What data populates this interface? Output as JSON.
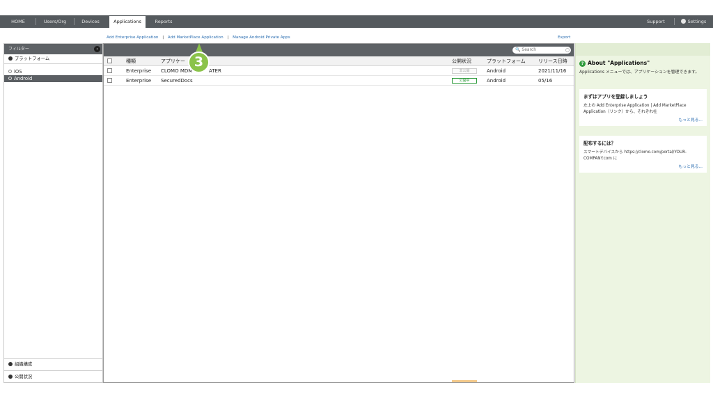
{
  "nav": {
    "tabs": [
      {
        "label": "HOME"
      },
      {
        "label": "Users/Org"
      },
      {
        "label": "Devices"
      },
      {
        "label": "Applications"
      },
      {
        "label": "Reports"
      }
    ],
    "active_tab": "Applications",
    "support": "Support",
    "settings": "Settings"
  },
  "actions": {
    "add_enterprise": "Add Enterprise Application",
    "add_marketplace": "Add MarketPlace Application",
    "manage_android": "Manage Android Private Apps",
    "separator": "|",
    "export": "Export"
  },
  "sidebar": {
    "filter_title": "フィルター",
    "platform_section": "プラットフォーム",
    "platforms": [
      {
        "label": "iOS",
        "selected": false
      },
      {
        "label": "Android",
        "selected": true
      }
    ],
    "org_section": "組織構成",
    "status_section": "公開状況"
  },
  "table": {
    "search_placeholder": "Search",
    "columns": [
      "種類",
      "アプリケー",
      "公開状況",
      "プラットフォーム",
      "リリース日時"
    ],
    "rows": [
      {
        "type": "Enterprise",
        "name": "CLOMO MDM",
        "name_tail": "ATER",
        "status": "非公開",
        "status_on": false,
        "platform": "Android",
        "release": "2021/11/16"
      },
      {
        "type": "Enterprise",
        "name": "SecuredDocs",
        "name_tail": "",
        "status": "公開中",
        "status_on": true,
        "platform": "Android",
        "release": "05/16"
      }
    ]
  },
  "step_marker": "3",
  "help": {
    "title": "About \"Applications\"",
    "description": "Applications メニューでは、アプリケーションを管理できます。",
    "cards": [
      {
        "title": "まずはアプリを登録しましょう",
        "text": "左上の Add Enterprise Application | Add MarketPlace Application（リンク）から、それぞれ社",
        "more": "もっと見る..."
      },
      {
        "title": "配布するには？",
        "text": "スマートデバイスから https://clomo.com/portal/YOUR-COMPANY.com に",
        "more": "もっと見る..."
      }
    ]
  },
  "colors": {
    "nav_bg": "#555a5e",
    "link": "#2a6db0",
    "accent_green": "#8bc34a",
    "status_green": "#2e9b3c",
    "help_panel_bg": "#edf5e2"
  }
}
